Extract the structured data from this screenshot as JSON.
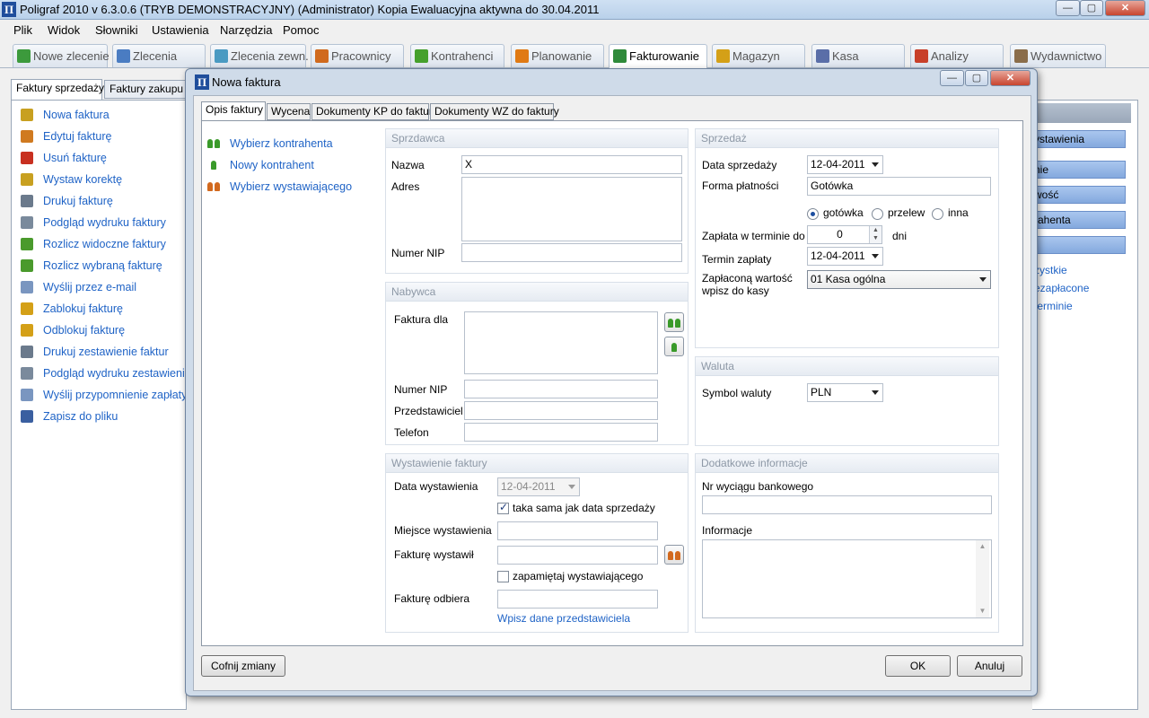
{
  "app": {
    "title": "Poligraf 2010 v 6.3.0.6 (TRYB DEMONSTRACYJNY) (Administrator) Kopia Ewaluacyjna aktywna do 30.04.2011",
    "icon": "poligraf-logo",
    "menu": [
      "Plik",
      "Widok",
      "Słowniki",
      "Ustawienia",
      "Narzędzia",
      "Pomoc"
    ],
    "window_buttons": {
      "minimize": "—",
      "maximize": "▢",
      "close": "✕"
    }
  },
  "toolbar_tabs": [
    {
      "label": "Nowe zlecenie",
      "icon": "new-order-icon",
      "color": "#3c9a3c"
    },
    {
      "label": "Zlecenia",
      "icon": "orders-icon",
      "color": "#4a7cc2"
    },
    {
      "label": "Zlecenia zewn.",
      "icon": "external-orders-icon",
      "color": "#4a9ac2"
    },
    {
      "label": "Pracownicy",
      "icon": "employees-icon",
      "color": "#d06a1e"
    },
    {
      "label": "Kontrahenci",
      "icon": "contractors-icon",
      "color": "#45a02c"
    },
    {
      "label": "Planowanie",
      "icon": "planning-icon",
      "color": "#e07a14"
    },
    {
      "label": "Fakturowanie",
      "icon": "invoicing-icon",
      "color": "#2f8a3a"
    },
    {
      "label": "Magazyn",
      "icon": "warehouse-icon",
      "color": "#d4a017"
    },
    {
      "label": "Kasa",
      "icon": "cash-icon",
      "color": "#5a6ea8"
    },
    {
      "label": "Analizy",
      "icon": "analytics-icon",
      "color": "#c8402a"
    },
    {
      "label": "Wydawnictwo",
      "icon": "publishing-icon",
      "color": "#8a6d4a"
    }
  ],
  "active_toolbar_tab": "Fakturowanie",
  "left": {
    "tabs": [
      "Faktury sprzedaży",
      "Faktury zakupu"
    ],
    "items": [
      {
        "label": "Nowa faktura",
        "icon": "new-invoice-icon",
        "color": "#c8a020"
      },
      {
        "label": "Edytuj fakturę",
        "icon": "edit-invoice-icon",
        "color": "#d07a20"
      },
      {
        "label": "Usuń fakturę",
        "icon": "delete-invoice-icon",
        "color": "#c83020"
      },
      {
        "label": "Wystaw korektę",
        "icon": "correction-icon",
        "color": "#c8a020"
      },
      {
        "label": "Drukuj fakturę",
        "icon": "print-icon",
        "color": "#6b7a8c"
      },
      {
        "label": "Podgląd wydruku faktury",
        "icon": "print-preview-icon",
        "color": "#7a8a9c"
      },
      {
        "label": "Rozlicz widoczne faktury",
        "icon": "settle-visible-icon",
        "color": "#4a9a2c"
      },
      {
        "label": "Rozlicz wybraną fakturę",
        "icon": "settle-selected-icon",
        "color": "#4a9a2c"
      },
      {
        "label": "Wyślij przez e-mail",
        "icon": "email-icon",
        "color": "#7a96c0"
      },
      {
        "label": "Zablokuj fakturę",
        "icon": "lock-icon",
        "color": "#d4a017"
      },
      {
        "label": "Odblokuj fakturę",
        "icon": "unlock-icon",
        "color": "#d4a017"
      },
      {
        "label": "Drukuj zestawienie faktur",
        "icon": "print-summary-icon",
        "color": "#6b7a8c"
      },
      {
        "label": "Podgląd wydruku zestawienia",
        "icon": "summary-preview-icon",
        "color": "#7a8a9c"
      },
      {
        "label": "Wyślij przypomnienie zapłaty",
        "icon": "reminder-email-icon",
        "color": "#7a96c0"
      },
      {
        "label": "Zapisz do pliku",
        "icon": "save-file-icon",
        "color": "#3a5fa0"
      }
    ]
  },
  "right": {
    "buttons": [
      "ystawienia",
      "nie",
      "wość",
      "rahenta",
      ""
    ],
    "links": [
      "zystkie",
      "ezapłacone",
      "terminie"
    ]
  },
  "dialog": {
    "title": "Nowa faktura",
    "tabs": [
      "Opis faktury",
      "Wycena",
      "Dokumenty KP do faktury",
      "Dokumenty WZ do faktury"
    ],
    "actions": [
      {
        "label": "Wybierz kontrahenta",
        "icon": "select-contractor-icon"
      },
      {
        "label": "Nowy kontrahent",
        "icon": "new-contractor-icon"
      },
      {
        "label": "Wybierz wystawiającego",
        "icon": "select-issuer-icon"
      }
    ],
    "seller": {
      "header": "Sprzdawca",
      "name_label": "Nazwa",
      "name_value": "X",
      "address_label": "Adres",
      "address_value": "",
      "nip_label": "Numer NIP",
      "nip_value": ""
    },
    "buyer": {
      "header": "Nabywca",
      "invoice_for_label": "Faktura dla",
      "invoice_for_value": "",
      "nip_label": "Numer NIP",
      "nip_value": "",
      "rep_label": "Przedstawiciel",
      "rep_value": "",
      "phone_label": "Telefon",
      "phone_value": ""
    },
    "issue": {
      "header": "Wystawienie faktury",
      "date_label": "Data wystawienia",
      "date_value": "12-04-2011",
      "same_as_sale_label": "taka sama jak data sprzedaży",
      "same_as_sale_checked": true,
      "place_label": "Miejsce wystawienia",
      "place_value": "",
      "issued_by_label": "Fakturę wystawił",
      "issued_by_value": "",
      "remember_label": "zapamiętaj wystawiającego",
      "remember_checked": false,
      "received_by_label": "Fakturę odbiera",
      "received_by_value": "",
      "enter_rep_link": "Wpisz dane przedstawiciela"
    },
    "sale": {
      "header": "Sprzedaż",
      "sale_date_label": "Data sprzedaży",
      "sale_date_value": "12-04-2011",
      "payment_form_label": "Forma płatności",
      "payment_form_value": "Gotówka",
      "payment_options": [
        "gotówka",
        "przelew",
        "inna"
      ],
      "payment_selected": "gotówka",
      "due_in_label": "Zapłata w terminie do",
      "due_in_value": "0",
      "due_in_unit": "dni",
      "due_date_label": "Termin zapłaty",
      "due_date_value": "12-04-2011",
      "paid_label_1": "Zapłaconą wartość",
      "paid_label_2": "wpisz do kasy",
      "cash_register_value": "01 Kasa ogólna"
    },
    "currency": {
      "header": "Waluta",
      "symbol_label": "Symbol waluty",
      "symbol_value": "PLN"
    },
    "extra": {
      "header": "Dodatkowe informacje",
      "bank_statement_label": "Nr wyciągu bankowego",
      "bank_statement_value": "",
      "info_label": "Informacje",
      "info_value": ""
    },
    "buttons": {
      "undo": "Cofnij zmiany",
      "ok": "OK",
      "cancel": "Anuluj"
    }
  }
}
